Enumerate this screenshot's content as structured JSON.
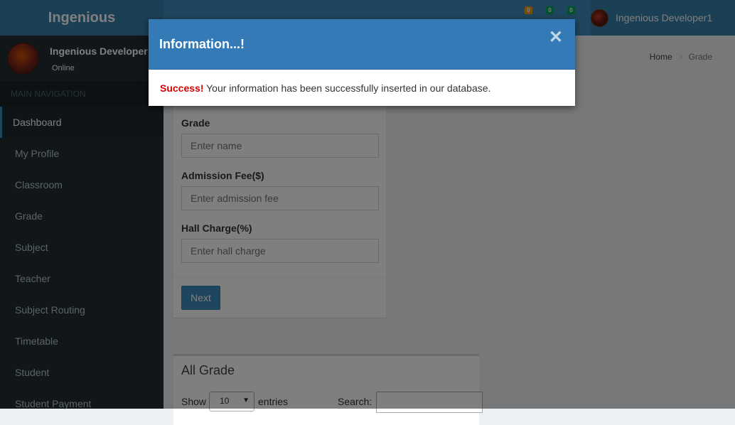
{
  "brand": {
    "name": "Ingenious"
  },
  "navbar": {
    "toggle_icon": "",
    "badges": [
      {
        "value": "0",
        "color": "#f39c12"
      },
      {
        "value": "0",
        "color": "#00a65a"
      },
      {
        "value": "0",
        "color": "#00a65a"
      }
    ],
    "user_name": "Ingenious Developer1"
  },
  "sidebar": {
    "user_name": "Ingenious Developer",
    "status": "Online",
    "header": "MAIN NAVIGATION",
    "items": [
      {
        "label": "Dashboard"
      },
      {
        "label": "My Profile"
      },
      {
        "label": "Classroom"
      },
      {
        "label": "Grade"
      },
      {
        "label": "Subject"
      },
      {
        "label": "Teacher"
      },
      {
        "label": "Subject Routing"
      },
      {
        "label": "Timetable"
      },
      {
        "label": "Student"
      },
      {
        "label": "Student Payment"
      }
    ]
  },
  "breadcrumb": {
    "home": "Home",
    "sep": ">",
    "current": "Grade"
  },
  "form": {
    "fields": [
      {
        "label": "Grade",
        "placeholder": "Enter name"
      },
      {
        "label": "Admission Fee($)",
        "placeholder": "Enter admission fee"
      },
      {
        "label": "Hall Charge(%)",
        "placeholder": "Enter hall charge"
      }
    ],
    "submit_label": "Next"
  },
  "grade_table": {
    "title": "All Grade",
    "show_label": "Show",
    "entries_value": "10",
    "entries_label": "entries",
    "search_label": "Search:"
  },
  "modal": {
    "title": "Information...!",
    "close_icon": "✕",
    "success_label": "Success!",
    "message": " Your information has been successfully inserted in our database."
  }
}
